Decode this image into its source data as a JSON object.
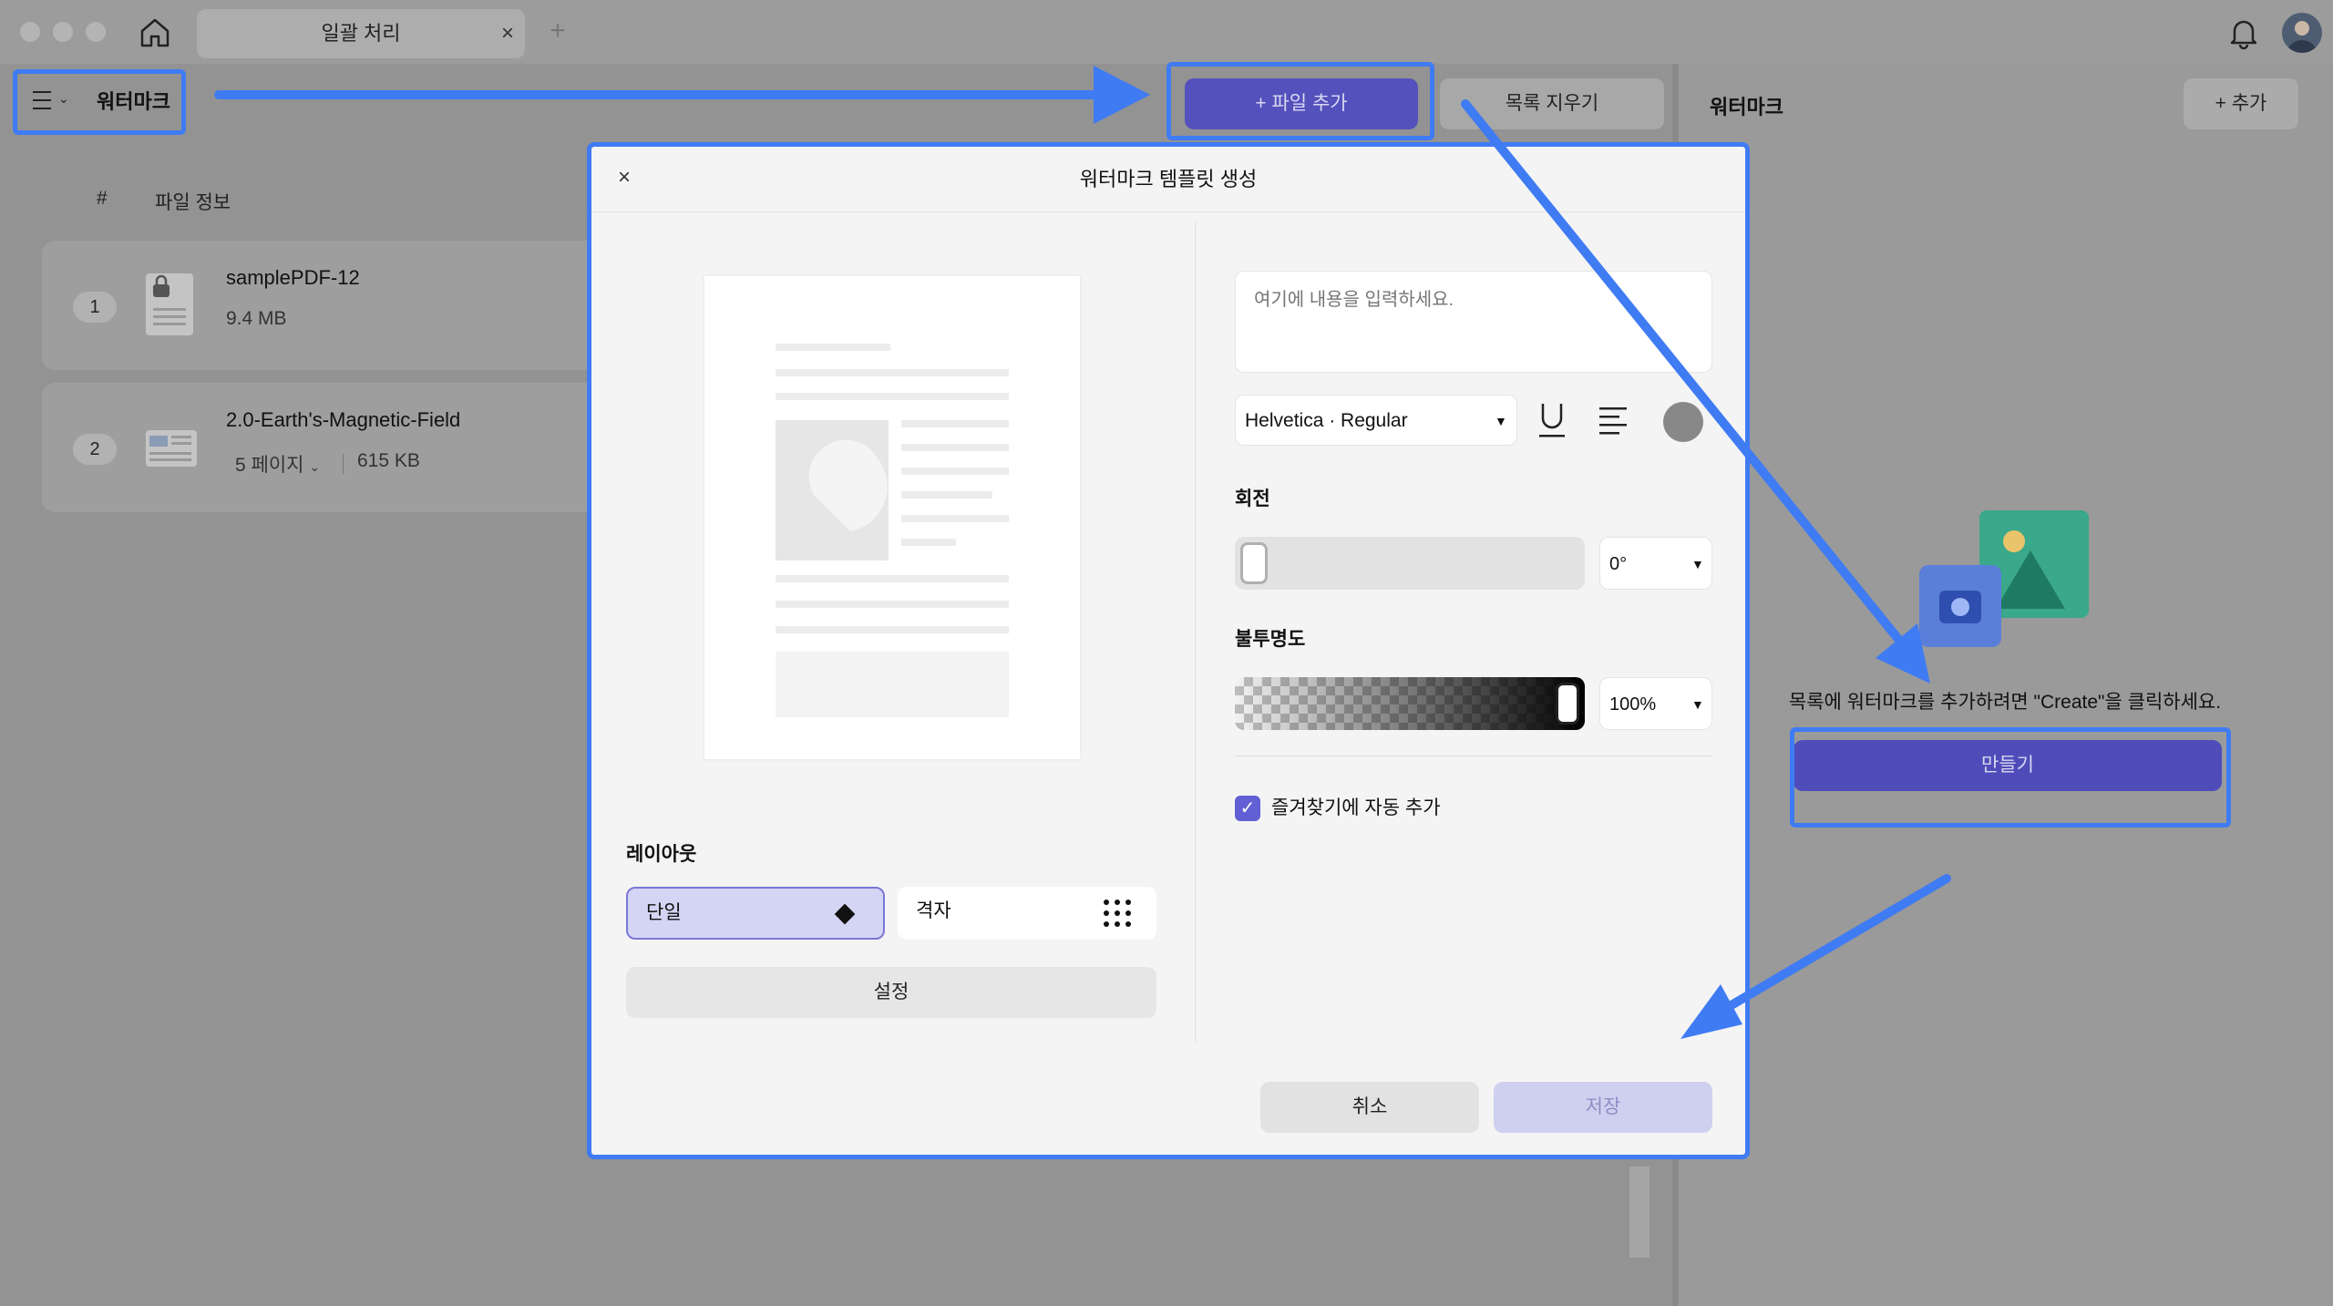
{
  "titlebar": {
    "tab_title": "일괄 처리",
    "tab_close": "×",
    "tab_add": "+"
  },
  "header": {
    "menu_label": "워터마크",
    "add_file": "+ 파일 추가",
    "clear_list": "목록 지우기"
  },
  "file_table": {
    "columns": [
      "#",
      "파일 정보"
    ],
    "files": [
      {
        "num": "1",
        "name": "samplePDF-12",
        "size": "9.4 MB",
        "pages": ""
      },
      {
        "num": "2",
        "name": "2.0-Earth's-Magnetic-Field",
        "pages": "5 페이지",
        "size": "615 KB"
      }
    ]
  },
  "right_panel": {
    "title": "워터마크",
    "add": "+ 추가",
    "message": "목록에 워터마크를 추가하려면 \"Create\"을 클릭하세요.",
    "create": "만들기"
  },
  "modal": {
    "title": "워터마크 템플릿 생성",
    "close": "×",
    "text_placeholder": "여기에 내용을 입력하세요.",
    "font": "Helvetica · Regular",
    "rotation_label": "회전",
    "rotation_value": "0°",
    "rotation_level": 0,
    "opacity_label": "불투명도",
    "opacity_value": "100%",
    "opacity_level": 1.0,
    "favorite_label": "즐겨찾기에 자동 추가",
    "favorite_checked": true,
    "layout_label": "레이아웃",
    "layout_single": "단일",
    "layout_grid": "격자",
    "settings": "설정",
    "cancel": "취소",
    "save": "저장"
  },
  "colors": {
    "accent": "#5451bd",
    "annotation": "#3f7bf3"
  },
  "icons": [
    "home-icon",
    "bell-icon",
    "hamburger-icon",
    "chevron-down-icon",
    "close-icon",
    "underline-icon",
    "align-left-icon",
    "diamond-icon",
    "grid-dots-icon",
    "checkmark-icon"
  ]
}
